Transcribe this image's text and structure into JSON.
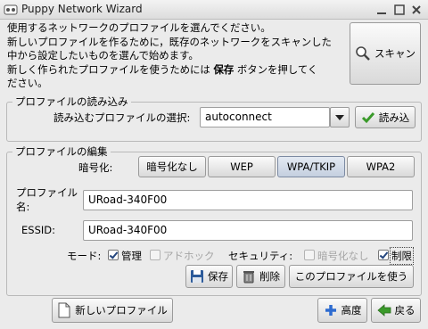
{
  "window": {
    "title": "Puppy Network Wizard",
    "buttons": [
      "minimize",
      "maximize",
      "close"
    ]
  },
  "intro": {
    "line1": "使用するネットワークのプロファイルを選んでください。",
    "line2": "新しいプロファイルを作るために，既存のネットワークをスキャンした",
    "line3": "中から設定したいものを選んで始めます。",
    "line4_pre": "新しく作られたプロファイルを使うためには ",
    "line4_bold": "保存",
    "line4_post": " ボタンを押してく",
    "line5": "ださい。"
  },
  "scan_button": {
    "label": "スキャン",
    "icon": "magnifier-icon"
  },
  "load_section": {
    "title": "プロファイルの読み込み",
    "select_label": "読み込むプロファイルの選択:",
    "selected_profile": "autoconnect",
    "load_button": "読み込"
  },
  "edit_section": {
    "title": "プロファイルの編集",
    "encryption_label": "暗号化:",
    "encryption_options": [
      {
        "label": "暗号化なし",
        "active": false
      },
      {
        "label": "WEP",
        "active": false
      },
      {
        "label": "WPA/TKIP",
        "active": true
      },
      {
        "label": "WPA2",
        "active": false
      }
    ],
    "profile_name_label_line1": "プロファイル",
    "profile_name_label_line2": "名:",
    "profile_name_value": "URoad-340F00",
    "essid_label": "ESSID:",
    "essid_value": "URoad-340F00",
    "mode_label": "モード:",
    "mode_managed": {
      "label": "管理",
      "checked": true,
      "enabled": true
    },
    "mode_adhoc": {
      "label": "アドホック",
      "checked": false,
      "enabled": false
    },
    "security_label": "セキュリティ:",
    "security_open": {
      "label": "暗号化なし",
      "checked": false,
      "enabled": false
    },
    "security_restricted": {
      "label": "制限",
      "checked": true,
      "enabled": true
    },
    "save_button": "保存",
    "delete_button": "削除",
    "use_profile_button": "このプロファイルを使う"
  },
  "footer": {
    "new_profile_button": "新しいプロファイル",
    "advanced_button": "高度",
    "back_button": "戻る"
  }
}
